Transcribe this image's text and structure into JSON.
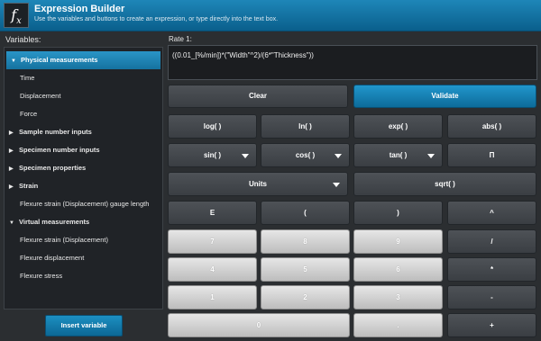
{
  "header": {
    "icon": "fx-icon",
    "title": "Expression Builder",
    "subtitle": "Use the variables and buttons to create an expression, or type directly into the text box."
  },
  "variables": {
    "label": "Variables:",
    "items": [
      {
        "label": "Physical measurements",
        "group": true,
        "expanded": true,
        "selected": true
      },
      {
        "label": "Time",
        "group": false
      },
      {
        "label": "Displacement",
        "group": false
      },
      {
        "label": "Force",
        "group": false
      },
      {
        "label": "Sample number inputs",
        "group": true,
        "expanded": false
      },
      {
        "label": "Specimen number inputs",
        "group": true,
        "expanded": false
      },
      {
        "label": "Specimen properties",
        "group": true,
        "expanded": false
      },
      {
        "label": "Strain",
        "group": true,
        "expanded": false
      },
      {
        "label": "Flexure strain (Displacement) gauge length",
        "group": false
      },
      {
        "label": "Virtual measurements",
        "group": true,
        "expanded": true
      },
      {
        "label": "Flexure strain (Displacement)",
        "group": false
      },
      {
        "label": "Flexure displacement",
        "group": false
      },
      {
        "label": "Flexure stress",
        "group": false
      }
    ],
    "insert_label": "Insert variable"
  },
  "expression": {
    "label": "Rate 1:",
    "value": "((0.01_[%/min])*(\"Width\"^2)/(6*\"Thickness\"))"
  },
  "buttons": {
    "clear": "Clear",
    "validate": "Validate",
    "log": "log( )",
    "ln": "ln( )",
    "exp": "exp( )",
    "abs": "abs( )",
    "sin": "sin( )",
    "cos": "cos( )",
    "tan": "tan( )",
    "pi": "Π",
    "units": "Units",
    "sqrt": "sqrt( )",
    "e": "E",
    "lparen": "(",
    "rparen": ")",
    "pow": "^",
    "n7": "7",
    "n8": "8",
    "n9": "9",
    "div": "/",
    "n4": "4",
    "n5": "5",
    "n6": "6",
    "mul": "*",
    "n1": "1",
    "n2": "2",
    "n3": "3",
    "sub": "-",
    "n0": "0",
    "dot": ".",
    "add": "+"
  },
  "colors": {
    "accent": "#1a86b9",
    "background": "#2b2e31"
  }
}
